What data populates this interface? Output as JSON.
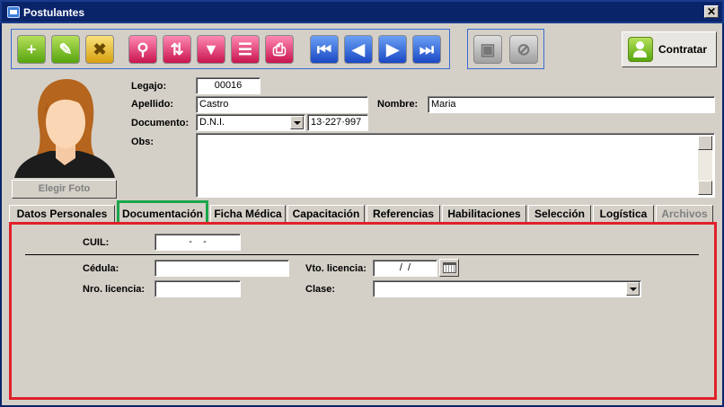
{
  "window": {
    "title": "Postulantes",
    "close_label": "✕"
  },
  "toolbar": {
    "buttons": [
      {
        "name": "add-button",
        "glyph": "+"
      },
      {
        "name": "edit-button",
        "glyph": "✎"
      },
      {
        "name": "delete-button",
        "glyph": "✖"
      },
      {
        "name": "search-button",
        "glyph": "⚲"
      },
      {
        "name": "sort-button",
        "glyph": "⇅"
      },
      {
        "name": "filter-button",
        "glyph": "▼"
      },
      {
        "name": "report-button",
        "glyph": "☰"
      },
      {
        "name": "print-button",
        "glyph": "⎙"
      },
      {
        "name": "first-record-button",
        "glyph": "⏮"
      },
      {
        "name": "prev-record-button",
        "glyph": "◀"
      },
      {
        "name": "next-record-button",
        "glyph": "▶"
      },
      {
        "name": "last-record-button",
        "glyph": "⏭"
      },
      {
        "name": "save-button",
        "glyph": "▣"
      },
      {
        "name": "cancel-button",
        "glyph": "⊘"
      }
    ],
    "contratar_label": "Contratar"
  },
  "photo": {
    "button_label": "Elegir Foto"
  },
  "form": {
    "legajo_label": "Legajo:",
    "legajo_value": "00016",
    "apellido_label": "Apellido:",
    "apellido_value": "Castro",
    "nombre_label": "Nombre:",
    "nombre_value": "Maria",
    "documento_label": "Documento:",
    "documento_tipo": "D.N.I.",
    "documento_numero": "13·227·997",
    "obs_label": "Obs:",
    "obs_value": ""
  },
  "tabs": [
    {
      "label": "Datos Personales"
    },
    {
      "label": "Documentación",
      "active": true
    },
    {
      "label": "Ficha Médica"
    },
    {
      "label": "Capacitación"
    },
    {
      "label": "Referencias"
    },
    {
      "label": "Habilitaciones"
    },
    {
      "label": "Selección"
    },
    {
      "label": "Logística"
    },
    {
      "label": "Archivos",
      "disabled": true
    }
  ],
  "documentacion": {
    "cuil_label": "CUIL:",
    "cuil_value": "-    -",
    "cedula_label": "Cédula:",
    "cedula_value": "",
    "vto_licencia_label": "Vto. licencia:",
    "vto_licencia_value": "/  /",
    "nro_licencia_label": "Nro. licencia:",
    "nro_licencia_value": "",
    "clase_label": "Clase:",
    "clase_value": ""
  },
  "colors": {
    "title_bar": "#0a246a",
    "active_tab_border": "#1aa64a",
    "panel_border": "#e0202a",
    "toolbar_group_border": "#3a6ad0"
  }
}
